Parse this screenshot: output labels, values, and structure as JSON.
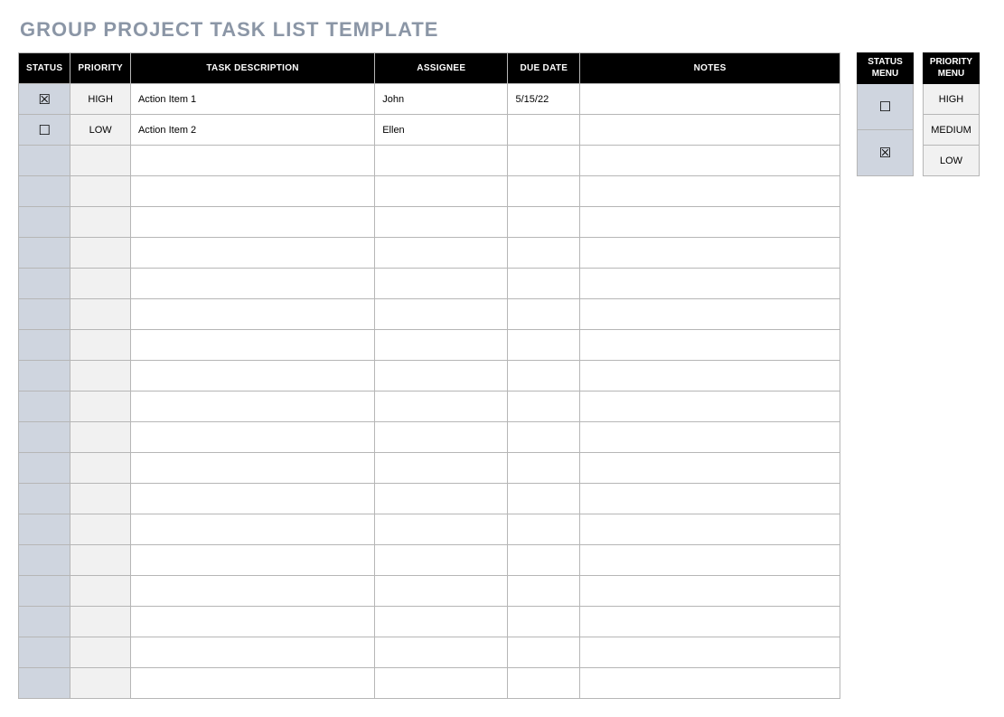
{
  "title": "GROUP PROJECT TASK LIST TEMPLATE",
  "columns": {
    "status": "STATUS",
    "priority": "PRIORITY",
    "description": "TASK DESCRIPTION",
    "assignee": "ASSIGNEE",
    "due": "DUE DATE",
    "notes": "NOTES"
  },
  "rows": [
    {
      "status": "☒",
      "priority": "HIGH",
      "description": "Action Item 1",
      "assignee": "John",
      "due": "5/15/22",
      "notes": ""
    },
    {
      "status": "☐",
      "priority": "LOW",
      "description": "Action Item 2",
      "assignee": "Ellen",
      "due": "",
      "notes": ""
    },
    {
      "status": "",
      "priority": "",
      "description": "",
      "assignee": "",
      "due": "",
      "notes": ""
    },
    {
      "status": "",
      "priority": "",
      "description": "",
      "assignee": "",
      "due": "",
      "notes": ""
    },
    {
      "status": "",
      "priority": "",
      "description": "",
      "assignee": "",
      "due": "",
      "notes": ""
    },
    {
      "status": "",
      "priority": "",
      "description": "",
      "assignee": "",
      "due": "",
      "notes": ""
    },
    {
      "status": "",
      "priority": "",
      "description": "",
      "assignee": "",
      "due": "",
      "notes": ""
    },
    {
      "status": "",
      "priority": "",
      "description": "",
      "assignee": "",
      "due": "",
      "notes": ""
    },
    {
      "status": "",
      "priority": "",
      "description": "",
      "assignee": "",
      "due": "",
      "notes": ""
    },
    {
      "status": "",
      "priority": "",
      "description": "",
      "assignee": "",
      "due": "",
      "notes": ""
    },
    {
      "status": "",
      "priority": "",
      "description": "",
      "assignee": "",
      "due": "",
      "notes": ""
    },
    {
      "status": "",
      "priority": "",
      "description": "",
      "assignee": "",
      "due": "",
      "notes": ""
    },
    {
      "status": "",
      "priority": "",
      "description": "",
      "assignee": "",
      "due": "",
      "notes": ""
    },
    {
      "status": "",
      "priority": "",
      "description": "",
      "assignee": "",
      "due": "",
      "notes": ""
    },
    {
      "status": "",
      "priority": "",
      "description": "",
      "assignee": "",
      "due": "",
      "notes": ""
    },
    {
      "status": "",
      "priority": "",
      "description": "",
      "assignee": "",
      "due": "",
      "notes": ""
    },
    {
      "status": "",
      "priority": "",
      "description": "",
      "assignee": "",
      "due": "",
      "notes": ""
    },
    {
      "status": "",
      "priority": "",
      "description": "",
      "assignee": "",
      "due": "",
      "notes": ""
    },
    {
      "status": "",
      "priority": "",
      "description": "",
      "assignee": "",
      "due": "",
      "notes": ""
    },
    {
      "status": "",
      "priority": "",
      "description": "",
      "assignee": "",
      "due": "",
      "notes": ""
    }
  ],
  "status_menu": {
    "header": "STATUS MENU",
    "items": [
      "☐",
      "☒"
    ]
  },
  "priority_menu": {
    "header": "PRIORITY MENU",
    "items": [
      "HIGH",
      "MEDIUM",
      "LOW"
    ]
  }
}
